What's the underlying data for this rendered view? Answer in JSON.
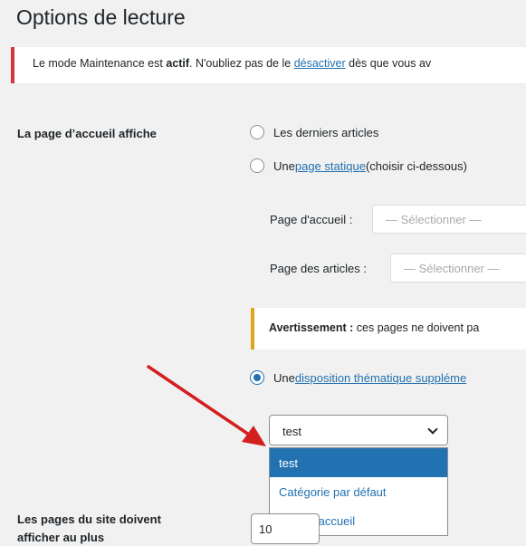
{
  "page": {
    "title": "Options de lecture"
  },
  "notice": {
    "prefix": "Le mode Maintenance est ",
    "strong": "actif",
    "middle": ". N'oubliez pas de le ",
    "link": "désactiver",
    "suffix": " dès que vous av"
  },
  "front": {
    "label": "La page d’accueil affiche",
    "option_latest": "Les derniers articles",
    "option_static_prefix": "Une ",
    "option_static_link": "page statique",
    "option_static_suffix": " (choisir ci-dessous)",
    "homepage_label": "Page d'accueil :",
    "homepage_value": "— Sélectionner —",
    "posts_label": "Page des articles :",
    "posts_value": "— Sélectionner —",
    "warning_strong": "Avertissement :",
    "warning_text": " ces pages ne doivent pa",
    "option_theme_prefix": "Une ",
    "option_theme_link": "disposition thématique suppléme",
    "layout_select_value": "test",
    "layout_options": [
      "test",
      "Catégorie par défaut",
      "Page d'accueil"
    ],
    "selected_option_index": 0
  },
  "posts_per_page": {
    "label_line1": "Les pages du site doivent",
    "label_line2": "afficher au plus",
    "value": "10"
  },
  "colors": {
    "accent": "#2271b1",
    "error": "#d63638",
    "warning": "#dba617",
    "annotation_arrow": "#d41f1f"
  }
}
